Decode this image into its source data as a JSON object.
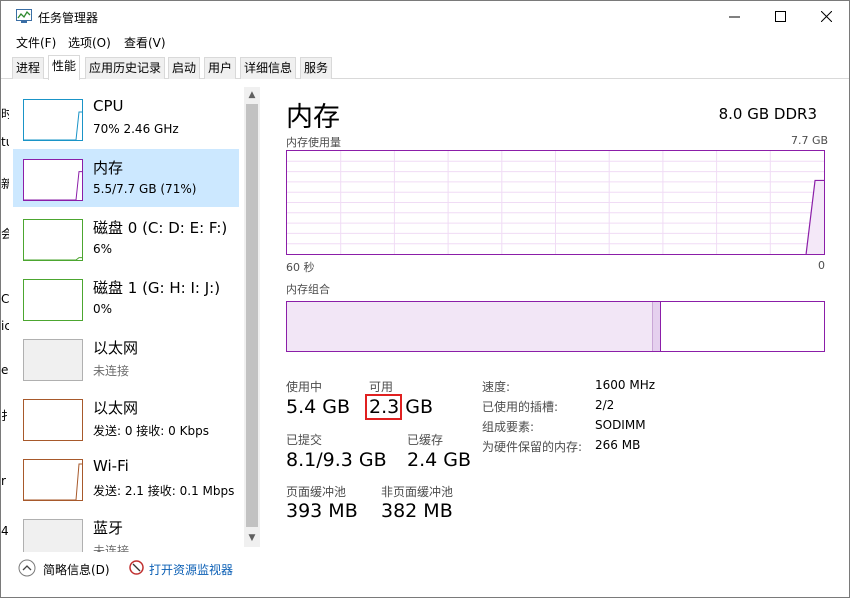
{
  "window": {
    "title": "任务管理器"
  },
  "menu": [
    {
      "label": "文件(F)"
    },
    {
      "label": "选项(O)"
    },
    {
      "label": "查看(V)"
    }
  ],
  "tabs": [
    {
      "label": "进程"
    },
    {
      "label": "性能"
    },
    {
      "label": "应用历史记录"
    },
    {
      "label": "启动"
    },
    {
      "label": "用户"
    },
    {
      "label": "详细信息"
    },
    {
      "label": "服务"
    }
  ],
  "active_tab": "性能",
  "sidebar": {
    "items": [
      {
        "title": "CPU",
        "sub": "70% 2.46 GHz",
        "color": "#1a94c7",
        "level": 0.7
      },
      {
        "title": "内存",
        "sub": "5.5/7.7 GB (71%)",
        "color": "#8b1ea8",
        "level": 0.71
      },
      {
        "title": "磁盘 0 (C: D: E: F:)",
        "sub": "6%",
        "color": "#4ca630",
        "level": 0.06
      },
      {
        "title": "磁盘 1 (G: H: I: J:)",
        "sub": "0%",
        "color": "#4ca630",
        "level": 0.0
      },
      {
        "title": "以太网",
        "sub": "未连接",
        "color": "#b0b0b0",
        "level": 0
      },
      {
        "title": "以太网",
        "sub": "发送: 0 接收: 0 Kbps",
        "color": "#a7592b",
        "level": 0
      },
      {
        "title": "Wi-Fi",
        "sub": "发送: 2.1 接收: 0.1 Mbps",
        "color": "#a7592b",
        "level": 0.9
      },
      {
        "title": "蓝牙",
        "sub": "未连接",
        "color": "#b0b0b0",
        "level": 0
      }
    ]
  },
  "left_edge_chars": [
    "时",
    "tu",
    "新",
    "会",
    "C",
    "ic",
    "e",
    "扌",
    "r",
    "4"
  ],
  "main": {
    "title": "内存",
    "spec": "8.0 GB DDR3",
    "usage_graph_label": "内存使用量",
    "usage_graph_max": "7.7 GB",
    "axis_left": "60 秒",
    "axis_right": "0",
    "composition_label": "内存组合",
    "composition_in_use_fraction": 0.696,
    "stats": {
      "in_use_label": "使用中",
      "in_use_value": "5.4 GB",
      "available_label": "可用",
      "available_value": "2.3 GB",
      "available_number": "2.3",
      "available_unit": "GB",
      "committed_label": "已提交",
      "committed_value": "8.1/9.3 GB",
      "cached_label": "已缓存",
      "cached_value": "2.4 GB",
      "paged_pool_label": "页面缓冲池",
      "paged_pool_value": "393 MB",
      "nonpaged_pool_label": "非页面缓冲池",
      "nonpaged_pool_value": "382 MB"
    },
    "details": [
      {
        "key": "速度:",
        "value": "1600 MHz"
      },
      {
        "key": "已使用的插槽:",
        "value": "2/2"
      },
      {
        "key": "组成要素:",
        "value": "SODIMM"
      },
      {
        "key": "为硬件保留的内存:",
        "value": "266 MB"
      }
    ]
  },
  "footer": {
    "brief_label": "简略信息(D)",
    "monitor_label": "打开资源监视器"
  },
  "chart_data": {
    "type": "area",
    "title": "内存使用量",
    "xlabel": "",
    "ylabel": "",
    "x": [
      60,
      3,
      2,
      1,
      0
    ],
    "values": [
      null,
      null,
      0,
      5.5,
      5.5
    ],
    "ylim": [
      0,
      7.7
    ],
    "x_tick_labels": [
      "60 秒",
      "0"
    ]
  },
  "colors": {
    "memory": "#8b1ea8",
    "selected": "#cce8ff",
    "highlight": "#e02020"
  }
}
